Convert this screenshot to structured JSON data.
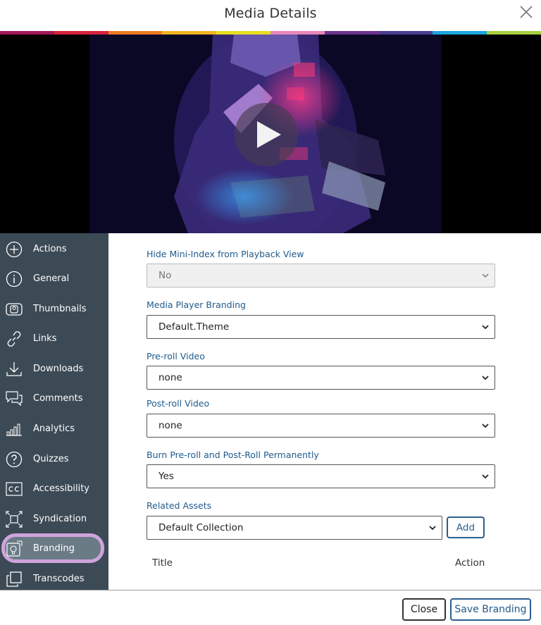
{
  "modal": {
    "title": "Media Details"
  },
  "colors": {
    "rainbow": [
      "#a3195b",
      "#d8233c",
      "#ef7b22",
      "#f2b321",
      "#e7df1f",
      "#e887b9",
      "#6d3391",
      "#4b3e92",
      "#1ba6de",
      "#a6cf3d"
    ],
    "sidebar_bg": "#3c4a55",
    "active_ring": "#cfa3dc",
    "label_blue": "#1e5a8c"
  },
  "sidebar": {
    "items": [
      {
        "label": "Actions",
        "icon": "plus-circle-icon"
      },
      {
        "label": "General",
        "icon": "info-circle-icon"
      },
      {
        "label": "Thumbnails",
        "icon": "thumbnails-icon"
      },
      {
        "label": "Links",
        "icon": "link-icon"
      },
      {
        "label": "Downloads",
        "icon": "download-icon"
      },
      {
        "label": "Comments",
        "icon": "comments-icon"
      },
      {
        "label": "Analytics",
        "icon": "analytics-icon"
      },
      {
        "label": "Quizzes",
        "icon": "question-circle-icon"
      },
      {
        "label": "Accessibility",
        "icon": "cc-icon"
      },
      {
        "label": "Syndication",
        "icon": "syndication-icon"
      },
      {
        "label": "Branding",
        "icon": "branding-icon",
        "active": true
      },
      {
        "label": "Transcodes",
        "icon": "transcodes-icon"
      }
    ]
  },
  "form": {
    "mini_index": {
      "label": "Hide Mini-Index from Playback View",
      "value": "No"
    },
    "branding": {
      "label": "Media Player Branding",
      "value": "Default.Theme"
    },
    "preroll": {
      "label": "Pre-roll Video",
      "value": "none"
    },
    "postroll": {
      "label": "Post-roll Video",
      "value": "none"
    },
    "burn": {
      "label": "Burn Pre-roll and Post-Roll Permanently",
      "value": "Yes"
    },
    "related": {
      "label": "Related Assets",
      "value": "Default Collection",
      "add_label": "Add"
    },
    "table": {
      "col_title": "Title",
      "col_action": "Action"
    }
  },
  "footer": {
    "close_label": "Close",
    "save_label": "Save Branding"
  }
}
